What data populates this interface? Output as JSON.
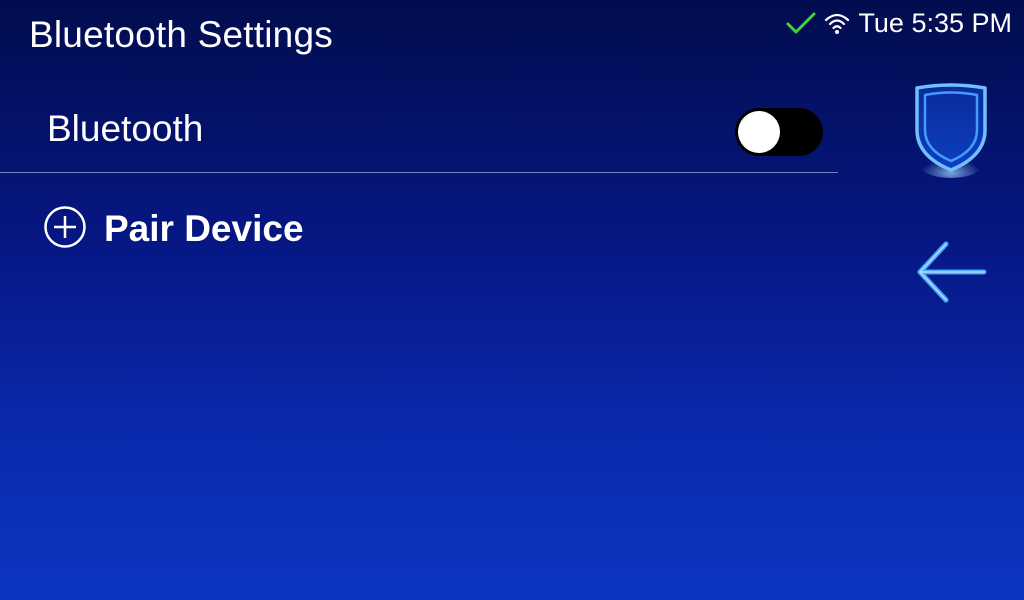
{
  "header": {
    "title": "Bluetooth Settings"
  },
  "status_bar": {
    "datetime": "Tue 5:35 PM",
    "status_icon": "checkmark-icon",
    "wifi_icon": "wifi-icon",
    "check_color": "#3fd23a"
  },
  "bluetooth": {
    "label": "Bluetooth",
    "enabled": false
  },
  "pair_device": {
    "label": "Pair Device",
    "icon": "plus-circle-icon"
  },
  "side_nav": {
    "shield_icon": "shield-icon",
    "back_icon": "back-arrow-icon",
    "accent_color": "#4aa8ff"
  }
}
